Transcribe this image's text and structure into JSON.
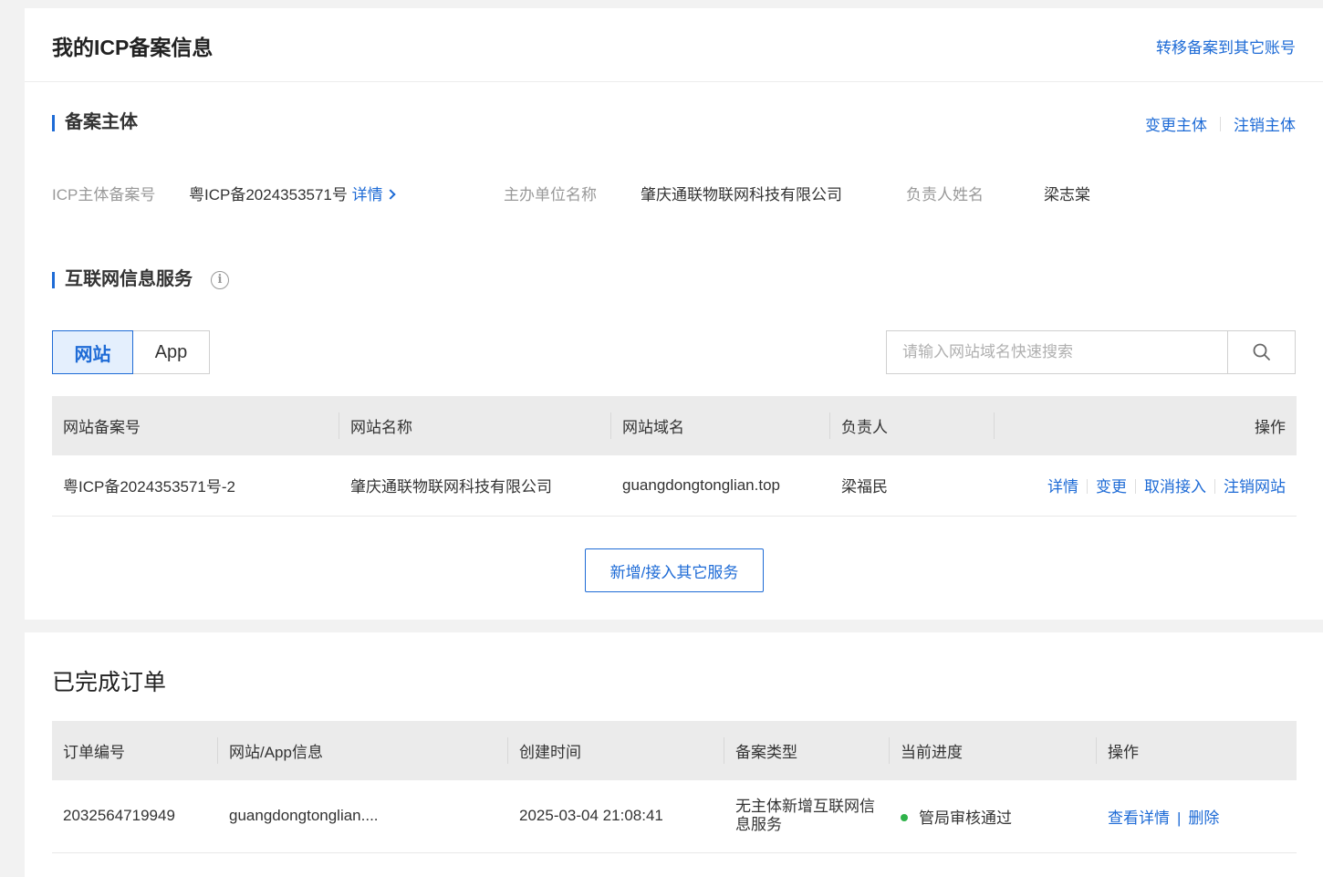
{
  "header": {
    "title": "我的ICP备案信息",
    "transfer_link": "转移备案到其它账号"
  },
  "subject": {
    "section_title": "备案主体",
    "change_link": "变更主体",
    "cancel_link": "注销主体",
    "icp_label": "ICP主体备案号",
    "icp_value": "粤ICP备2024353571号",
    "detail_link": "详情",
    "org_label": "主办单位名称",
    "org_value": "肇庆通联物联网科技有限公司",
    "owner_label": "负责人姓名",
    "owner_value": "梁志棠"
  },
  "internet": {
    "section_title": "互联网信息服务",
    "tabs": [
      {
        "label": "网站",
        "active": true
      },
      {
        "label": "App",
        "active": false
      }
    ],
    "search_placeholder": "请输入网站域名快速搜索",
    "table": {
      "headers": [
        "网站备案号",
        "网站名称",
        "网站域名",
        "负责人",
        "操作"
      ],
      "rows": [
        {
          "icp": "粤ICP备2024353571号-2",
          "name": "肇庆通联物联网科技有限公司",
          "domain": "guangdongtonglian.top",
          "owner": "梁福民",
          "actions": [
            "详情",
            "变更",
            "取消接入",
            "注销网站"
          ]
        }
      ]
    },
    "add_button": "新增/接入其它服务"
  },
  "orders": {
    "title": "已完成订单",
    "headers": [
      "订单编号",
      "网站/App信息",
      "创建时间",
      "备案类型",
      "当前进度",
      "操作"
    ],
    "rows": [
      {
        "order_no": "2032564719949",
        "info": "guangdongtonglian....",
        "created": "2025-03-04 21:08:41",
        "type": "无主体新增互联网信息服务",
        "status": "管局审核通过",
        "actions": [
          "查看详情",
          "删除"
        ]
      }
    ],
    "status_color": "#2fb34a"
  },
  "colors": {
    "accent": "#1e6bd6",
    "background": "#f2f2f2"
  }
}
